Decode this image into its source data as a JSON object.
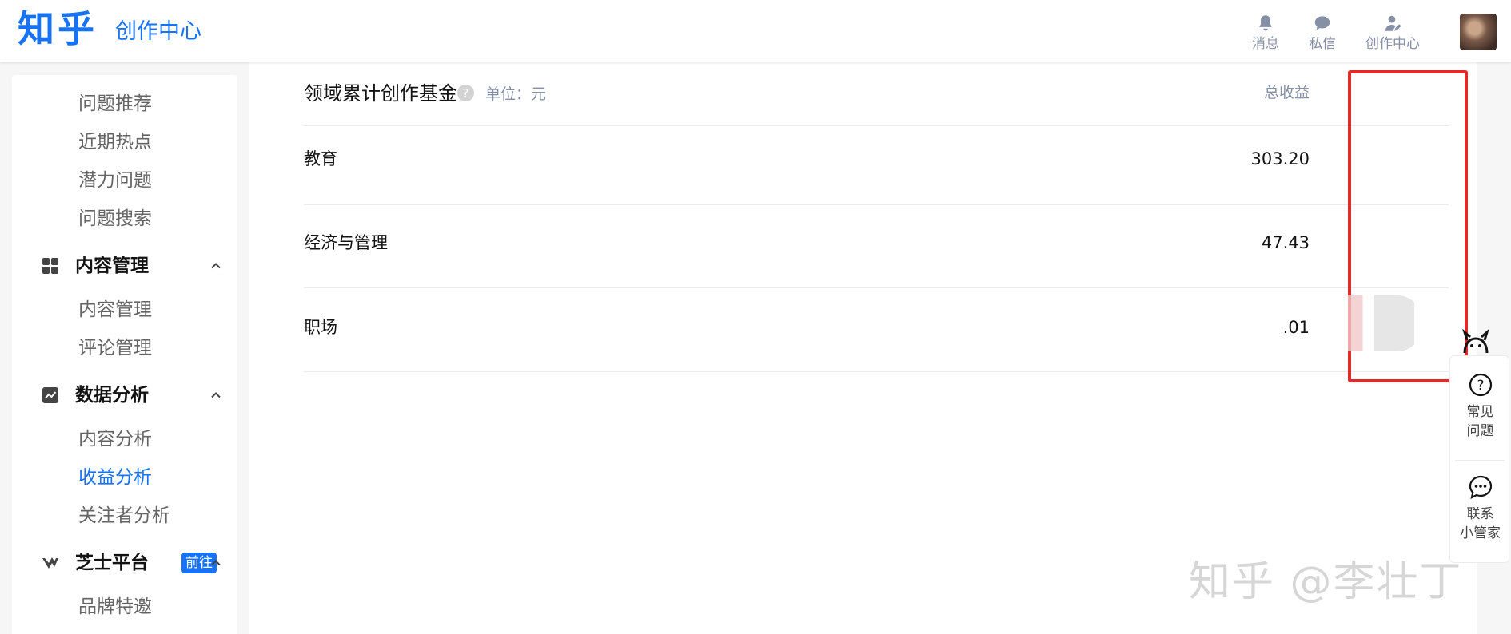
{
  "header": {
    "logo": "知乎",
    "subtitle": "创作中心",
    "actions": [
      {
        "label": "消息",
        "icon": "bell-icon"
      },
      {
        "label": "私信",
        "icon": "chat-icon"
      },
      {
        "label": "创作中心",
        "icon": "creator-icon"
      }
    ]
  },
  "sidebar": {
    "question_items": [
      "问题推荐",
      "近期热点",
      "潜力问题",
      "问题搜索"
    ],
    "groups": [
      {
        "label": "内容管理",
        "icon": "grid-icon",
        "items": [
          "内容管理",
          "评论管理"
        ]
      },
      {
        "label": "数据分析",
        "icon": "chart-icon",
        "items": [
          "内容分析",
          "收益分析",
          "关注者分析"
        ]
      },
      {
        "label": "芝士平台",
        "icon": "zhishi-icon",
        "badge": "前往",
        "items": [
          "品牌特邀"
        ]
      }
    ],
    "active_item": "收益分析"
  },
  "table": {
    "title": "领域累计创作基金",
    "unit": "单位：元",
    "column_header": "总收益",
    "rows": [
      {
        "name": "教育",
        "value": "303.20"
      },
      {
        "name": "经济与管理",
        "value": "47.43"
      },
      {
        "name": "职场",
        "value": ".01"
      }
    ]
  },
  "float_panel": {
    "faq": "常见\n问题",
    "contact": "联系\n小管家"
  },
  "watermark": "知乎 @李壮丁",
  "colors": {
    "brand": "#1772f6",
    "highlight_box": "#e02b2b",
    "muted": "#8590a6"
  }
}
